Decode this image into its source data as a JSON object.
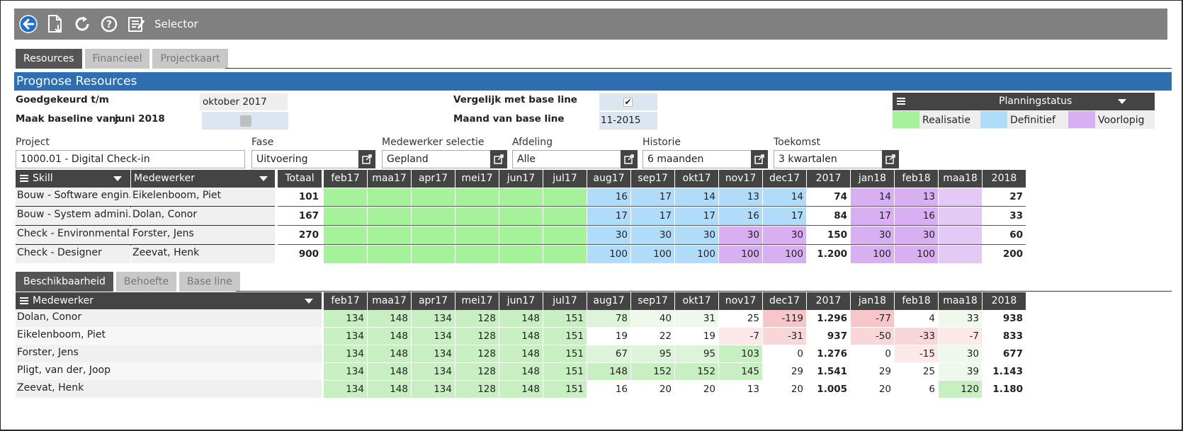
{
  "toolbar": {
    "title": "Selector"
  },
  "tabs": [
    "Resources",
    "Financieel",
    "Projectkaart"
  ],
  "section_title": "Prognose Resources",
  "form": {
    "approved_label": "Goedgekeurd t/m",
    "approved_value": "oktober 2017",
    "baseline_label": "Maak baseline van:",
    "baseline_value": "juni 2018",
    "compare_label": "Vergelijk met base line",
    "compare_checked": true,
    "compare_mark": "✔",
    "baseline_month_label": "Maand van base line",
    "baseline_month_value": "11-2015"
  },
  "planning_status": {
    "title": "Planningstatus",
    "legend": [
      {
        "label": "Realisatie",
        "color": "#a6f29a"
      },
      {
        "label": "Definitief",
        "color": "#b0dcfa"
      },
      {
        "label": "Voorlopig",
        "color": "#d8b0f2"
      }
    ]
  },
  "filters": [
    {
      "label": "Project",
      "value": "1000.01 - Digital Check-in"
    },
    {
      "label": "Fase",
      "value": "Uitvoering"
    },
    {
      "label": "Medewerker selectie",
      "value": "Gepland"
    },
    {
      "label": "Afdeling",
      "value": "Alle"
    },
    {
      "label": "Historie",
      "value": "6 maanden"
    },
    {
      "label": "Toekomst",
      "value": "3 kwartalen"
    }
  ],
  "months": [
    "feb17",
    "maa17",
    "apr17",
    "mei17",
    "jun17",
    "jul17",
    "aug17",
    "sep17",
    "okt17",
    "nov17",
    "dec17",
    "2017",
    "jan18",
    "feb18",
    "maa18",
    "2018"
  ],
  "resources": {
    "col_skill": "Skill",
    "col_employee": "Medewerker",
    "col_total": "Totaal",
    "rows": [
      {
        "skill": "Bouw - Software engin...",
        "employee": "Eikelenboom, Piet",
        "total": "101",
        "values": [
          "",
          "",
          "",
          "",
          "",
          "",
          "16",
          "17",
          "14",
          "13",
          "14",
          "74",
          "14",
          "13",
          "",
          "27"
        ]
      },
      {
        "skill": "Bouw - System admini...",
        "employee": "Dolan, Conor",
        "total": "167",
        "values": [
          "",
          "",
          "",
          "",
          "",
          "",
          "17",
          "17",
          "17",
          "16",
          "17",
          "84",
          "17",
          "16",
          "",
          "33"
        ]
      },
      {
        "skill": "Check - Environmental...",
        "employee": "Forster, Jens",
        "total": "270",
        "values": [
          "",
          "",
          "",
          "",
          "",
          "",
          "30",
          "30",
          "30",
          "30",
          "30",
          "150",
          "30",
          "30",
          "",
          "60"
        ]
      },
      {
        "skill": "Check - Designer",
        "employee": "Zeevat, Henk",
        "total": "900",
        "values": [
          "",
          "",
          "",
          "",
          "",
          "",
          "100",
          "100",
          "100",
          "100",
          "100",
          "1.200",
          "100",
          "100",
          "",
          "200"
        ]
      }
    ]
  },
  "subtabs": [
    "Beschikbaarheid",
    "Behoefte",
    "Base line"
  ],
  "availability": {
    "col_employee": "Medewerker",
    "rows": [
      {
        "employee": "Dolan, Conor",
        "values": [
          "134",
          "148",
          "134",
          "128",
          "148",
          "151",
          "78",
          "40",
          "31",
          "25",
          "-119",
          "1.296",
          "-77",
          "4",
          "33",
          "938"
        ]
      },
      {
        "employee": "Eikelenboom, Piet",
        "values": [
          "134",
          "148",
          "134",
          "128",
          "148",
          "151",
          "19",
          "22",
          "19",
          "-7",
          "-31",
          "937",
          "-50",
          "-33",
          "-7",
          "833"
        ]
      },
      {
        "employee": "Forster, Jens",
        "values": [
          "134",
          "148",
          "134",
          "128",
          "148",
          "151",
          "67",
          "95",
          "95",
          "103",
          "0",
          "1.276",
          "0",
          "-15",
          "30",
          "677"
        ]
      },
      {
        "employee": "Pligt, van der, Joop",
        "values": [
          "134",
          "148",
          "134",
          "128",
          "148",
          "151",
          "148",
          "152",
          "152",
          "145",
          "29",
          "1.541",
          "29",
          "25",
          "39",
          "1.143"
        ]
      },
      {
        "employee": "Zeevat, Henk",
        "values": [
          "134",
          "148",
          "134",
          "128",
          "148",
          "151",
          "16",
          "20",
          "20",
          "13",
          "20",
          "1.005",
          "20",
          "6",
          "120",
          "1.180"
        ]
      }
    ]
  }
}
